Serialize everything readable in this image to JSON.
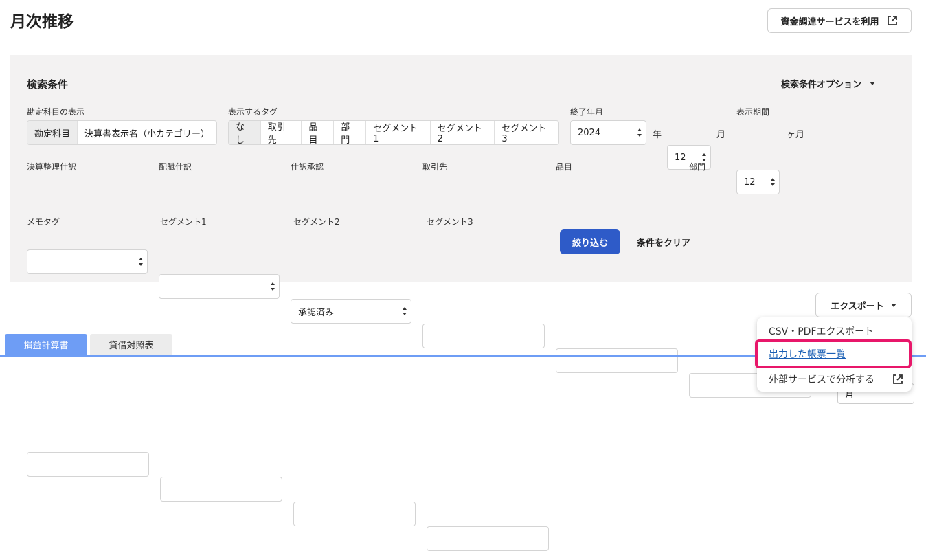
{
  "page": {
    "title": "月次推移"
  },
  "header": {
    "funding_button": "資金調達サービスを利用"
  },
  "search": {
    "title": "検索条件",
    "options_label": "検索条件オプション",
    "account_display": {
      "label": "勘定科目の表示",
      "options": [
        "勘定科目",
        "決算書表示名（小カテゴリー）"
      ],
      "selected": "勘定科目"
    },
    "tag_display": {
      "label": "表示するタグ",
      "options": [
        "なし",
        "取引先",
        "品目",
        "部門",
        "セグメント1",
        "セグメント2",
        "セグメント3"
      ],
      "selected": "なし"
    },
    "end_period": {
      "label": "終了年月",
      "year": "2024",
      "year_unit": "年",
      "month": "12",
      "month_unit": "月"
    },
    "display_period": {
      "label": "表示期間",
      "value": "12",
      "unit": "ヶ月"
    },
    "closing_entries": {
      "label": "決算整理仕訳",
      "value": ""
    },
    "allocation_entries": {
      "label": "配賦仕訳",
      "value": ""
    },
    "approval": {
      "label": "仕訳承認",
      "value": "承認済み"
    },
    "partner": {
      "label": "取引先",
      "value": ""
    },
    "item": {
      "label": "品目",
      "value": ""
    },
    "department": {
      "label": "部門",
      "value": ""
    },
    "memo_tag": {
      "label": "メモタグ",
      "value": ""
    },
    "segment1": {
      "label": "セグメント1",
      "value": ""
    },
    "segment2": {
      "label": "セグメント2",
      "value": ""
    },
    "segment3": {
      "label": "セグメント3",
      "value": ""
    },
    "filter_button": "絞り込む",
    "clear_button": "条件をクリア"
  },
  "export": {
    "button": "エクスポート",
    "menu": [
      "CSV・PDFエクスポート",
      "出力した帳票一覧",
      "外部サービスで分析する"
    ]
  },
  "tabs": [
    "損益計算書",
    "貸借対照表"
  ],
  "bottom_select": {
    "value": "月"
  },
  "colors": {
    "primary": "#2e5bc8",
    "tab_active": "#6e9df5",
    "highlight": "#e8176a",
    "link": "#1a5fb4"
  }
}
